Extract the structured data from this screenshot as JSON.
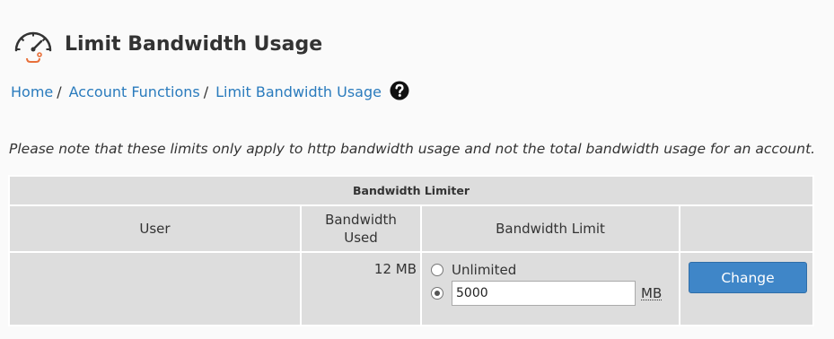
{
  "page": {
    "title": "Limit Bandwidth Usage"
  },
  "breadcrumb": {
    "items": [
      "Home",
      "Account Functions",
      "Limit Bandwidth Usage"
    ],
    "separator": "/"
  },
  "note": "Please note that these limits only apply to http bandwidth usage and not the total bandwidth usage for an account.",
  "table": {
    "caption": "Bandwidth Limiter",
    "columns": [
      "User",
      "Bandwidth Used",
      "Bandwidth Limit",
      ""
    ],
    "row": {
      "user": "",
      "used": "12 MB",
      "option_unlimited": "Unlimited",
      "unlimited_selected": false,
      "custom_selected": true,
      "limit_value": "5000",
      "unit": "MB",
      "button": "Change"
    }
  },
  "colors": {
    "accent": "#2a7bbd",
    "button": "#3f86c8",
    "gauge_accent": "#e8703a"
  },
  "icons": {
    "header": "speedometer-icon",
    "help": "question-circle-icon"
  }
}
